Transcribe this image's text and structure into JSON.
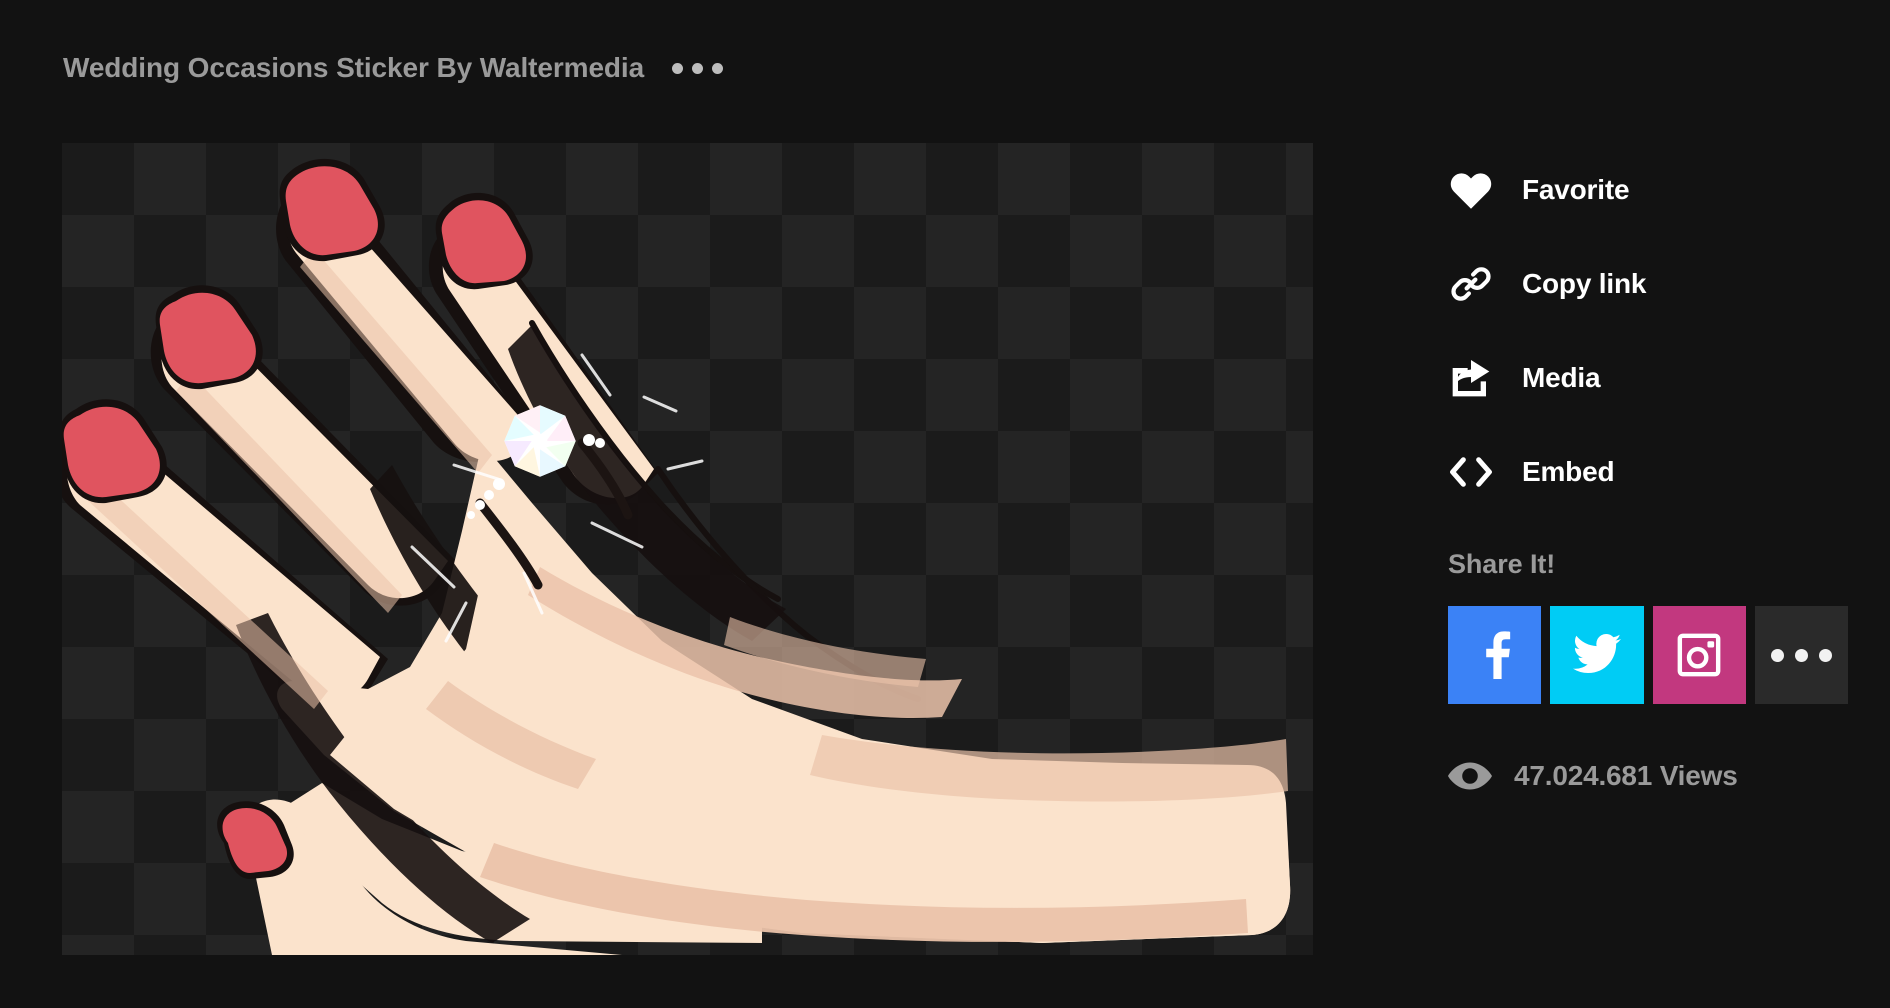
{
  "page": {
    "background": "#121212"
  },
  "header": {
    "title": "Wedding Occasions Sticker By Waltermedia",
    "menu_icon": "ellipsis-icon"
  },
  "viewer": {
    "canvas_label": "sticker-preview-canvas",
    "transparency_checkerboard": true,
    "checker_light": "#242424",
    "checker_dark": "#1b1b1b",
    "artwork": {
      "subject": "hand-with-engagement-ring",
      "skin_color": "#FBE3CC",
      "skin_shadow_color": "#EBC3AA",
      "nail_color": "#E0545F",
      "outline_color": "#1a1412",
      "diamond_color": "#FFFFFF"
    }
  },
  "sidebar": {
    "actions": [
      {
        "label": "Favorite",
        "icon": "heart-icon"
      },
      {
        "label": "Copy link",
        "icon": "link-icon"
      },
      {
        "label": "Media",
        "icon": "share-box-arrow-icon"
      },
      {
        "label": "Embed",
        "icon": "code-angle-brackets-icon"
      }
    ],
    "share": {
      "heading": "Share It!",
      "buttons": [
        {
          "name": "facebook",
          "icon": "facebook-icon",
          "color": "#3B82F6"
        },
        {
          "name": "twitter",
          "icon": "twitter-icon",
          "color": "#00CCF5"
        },
        {
          "name": "instagram",
          "icon": "instagram-icon",
          "color": "#C2387F"
        },
        {
          "name": "more",
          "icon": "ellipsis-icon",
          "color": "#2A2A2A"
        }
      ]
    },
    "views": {
      "icon": "eye-icon",
      "count": "47.024.681",
      "label": "47.024.681 Views"
    }
  }
}
